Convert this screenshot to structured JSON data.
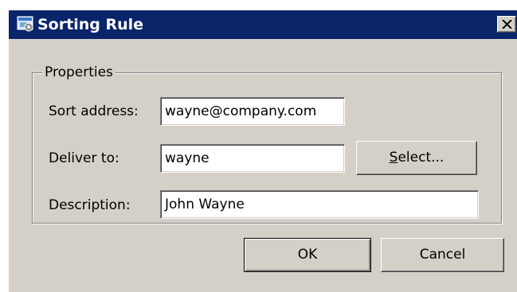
{
  "window": {
    "title": "Sorting Rule",
    "close_glyph": "✕"
  },
  "properties": {
    "group_label": "Properties",
    "sort_address_label": "Sort address:",
    "sort_address_value": "wayne@company.com",
    "deliver_to_label": "Deliver to:",
    "deliver_to_value": "wayne",
    "select_button_mnemonic": "S",
    "select_button_rest": "elect...",
    "description_label": "Description:",
    "description_value": "John Wayne"
  },
  "buttons": {
    "ok_label": "OK",
    "cancel_label": "Cancel"
  },
  "icons": {
    "title_icon": "app-icon",
    "close_icon": "close-icon"
  },
  "colors": {
    "titlebar": "#0a246a",
    "dialog_face": "#d4d0c8",
    "field_bg": "#ffffff"
  }
}
